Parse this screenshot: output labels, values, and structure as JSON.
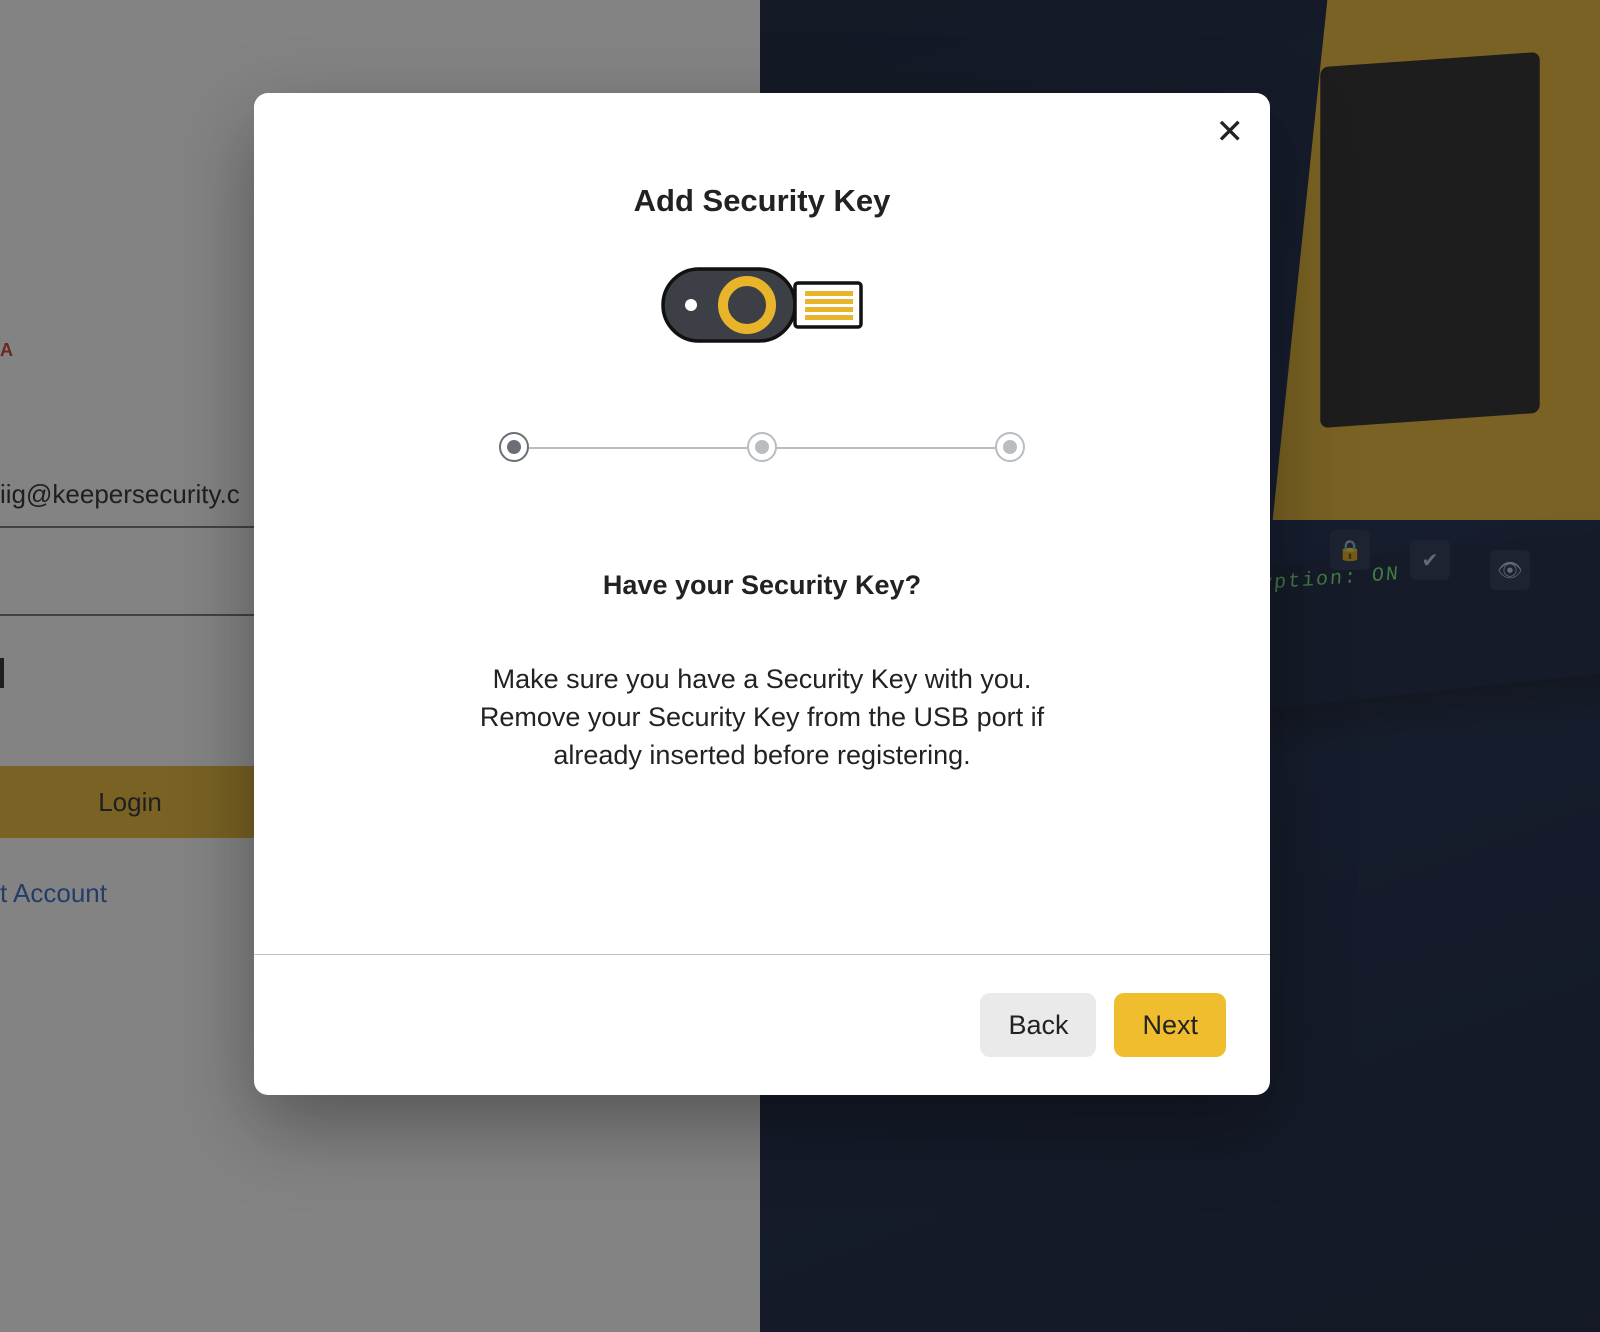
{
  "background": {
    "email_value": "iig@keepersecurity.c",
    "login_label": "Login",
    "create_link": "t Account",
    "powered_fragment": "A",
    "encryption_label": "encryption: ON"
  },
  "modal": {
    "title": "Add Security Key",
    "subheading": "Have your Security Key?",
    "description": "Make sure you have a Security Key with you. Remove your Security Key from the USB port if already inserted before registering.",
    "back_label": "Back",
    "next_label": "Next",
    "close_symbol": "✕",
    "steps_total": 3,
    "current_step": 1
  },
  "colors": {
    "accent": "#f0bd2f",
    "link": "#2a63c7",
    "error": "#c5322b"
  }
}
